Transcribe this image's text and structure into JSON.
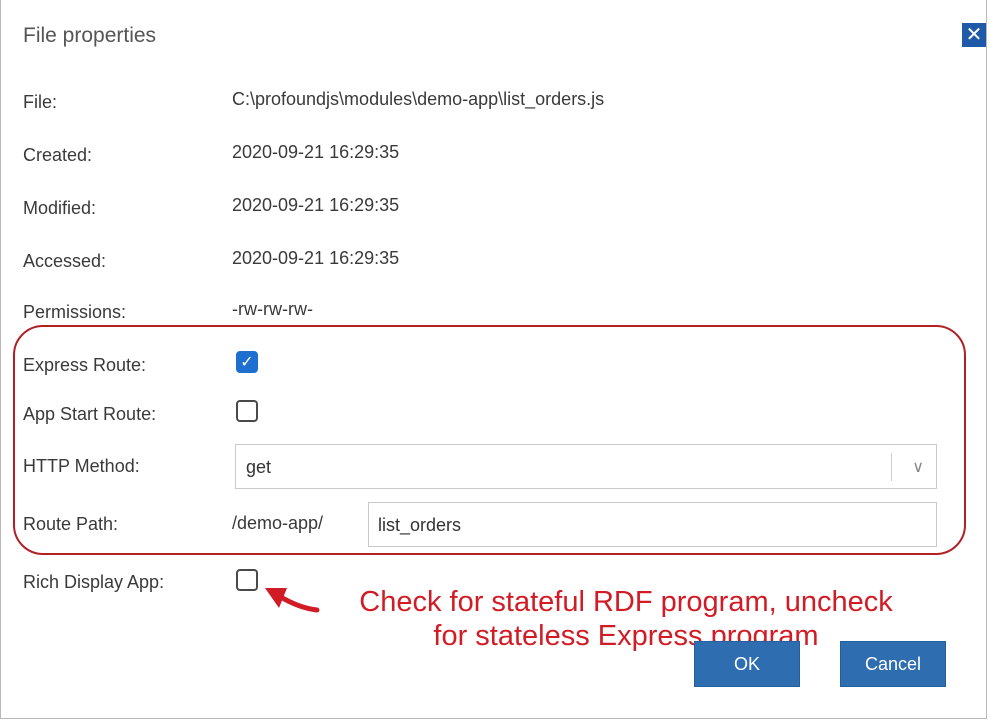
{
  "dialog": {
    "title": "File properties",
    "close_icon": "close-icon"
  },
  "fields": {
    "file": {
      "label": "File:",
      "value": "C:\\profoundjs\\modules\\demo-app\\list_orders.js"
    },
    "created": {
      "label": "Created:",
      "value": "2020-09-21 16:29:35"
    },
    "modified": {
      "label": "Modified:",
      "value": "2020-09-21 16:29:35"
    },
    "accessed": {
      "label": "Accessed:",
      "value": "2020-09-21 16:29:35"
    },
    "permissions": {
      "label": "Permissions:",
      "value": "-rw-rw-rw-"
    },
    "express_route": {
      "label": "Express Route:",
      "checked": true
    },
    "app_start_route": {
      "label": "App Start Route:",
      "checked": false
    },
    "http_method": {
      "label": "HTTP Method:",
      "selected": "get"
    },
    "route_path": {
      "label": "Route Path:",
      "prefix": "/demo-app/",
      "value": "list_orders"
    },
    "rich_display_app": {
      "label": "Rich Display App:",
      "checked": false
    }
  },
  "annotation": {
    "line1": "Check for stateful RDF program, uncheck",
    "line2": "for stateless Express program",
    "color": "#d21c25"
  },
  "buttons": {
    "ok_label": "OK",
    "cancel_label": "Cancel"
  },
  "colors": {
    "accent": "#2d6db0",
    "highlight": "#b02025"
  }
}
